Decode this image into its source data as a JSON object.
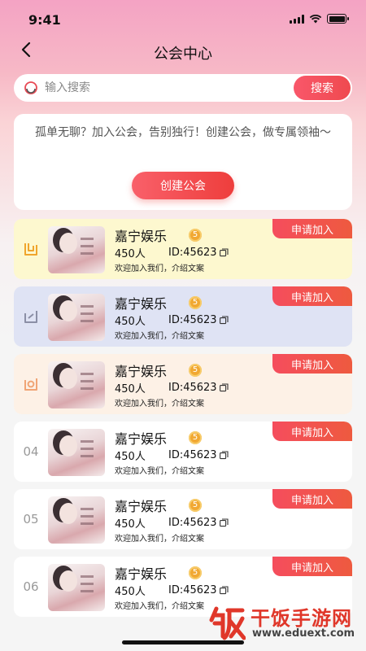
{
  "status_bar": {
    "time": "9:41"
  },
  "nav": {
    "title": "公会中心"
  },
  "search": {
    "placeholder": "输入搜索",
    "button_label": "搜索"
  },
  "promo": {
    "text": "孤单无聊？加入公会，告别独行！创建公会，做专属领袖～",
    "button_label": "创建公会"
  },
  "guilds": [
    {
      "rank": "",
      "rank_icon": "gold-medal-icon",
      "bg": "#fdf8cf",
      "name": "嘉宁娱乐",
      "level": "5",
      "members": "450人",
      "id": "ID:45623",
      "desc": "欢迎加入我们，介绍文案",
      "join_label": "申请加入"
    },
    {
      "rank": "",
      "rank_icon": "silver-medal-icon",
      "bg": "#dfe3f4",
      "name": "嘉宁娱乐",
      "level": "5",
      "members": "450人",
      "id": "ID:45623",
      "desc": "欢迎加入我们，介绍文案",
      "join_label": "申请加入"
    },
    {
      "rank": "",
      "rank_icon": "bronze-medal-icon",
      "bg": "#fdf1e6",
      "name": "嘉宁娱乐",
      "level": "5",
      "members": "450人",
      "id": "ID:45623",
      "desc": "欢迎加入我们，介绍文案",
      "join_label": "申请加入"
    },
    {
      "rank": "04",
      "rank_icon": "",
      "bg": "#ffffff",
      "name": "嘉宁娱乐",
      "level": "5",
      "members": "450人",
      "id": "ID:45623",
      "desc": "欢迎加入我们，介绍文案",
      "join_label": "申请加入"
    },
    {
      "rank": "05",
      "rank_icon": "",
      "bg": "#ffffff",
      "name": "嘉宁娱乐",
      "level": "5",
      "members": "450人",
      "id": "ID:45623",
      "desc": "欢迎加入我们，介绍文案",
      "join_label": "申请加入"
    },
    {
      "rank": "06",
      "rank_icon": "",
      "bg": "#ffffff",
      "name": "嘉宁娱乐",
      "level": "5",
      "members": "450人",
      "id": "ID:45623",
      "desc": "欢迎加入我们，介绍文案",
      "join_label": "申请加入"
    }
  ],
  "watermark": {
    "title": "干饭手游网",
    "url": "www.eduext.com"
  },
  "colors": {
    "accent": "#f0474f",
    "level_badge": "#f1a832",
    "watermark": "#e0372a"
  }
}
